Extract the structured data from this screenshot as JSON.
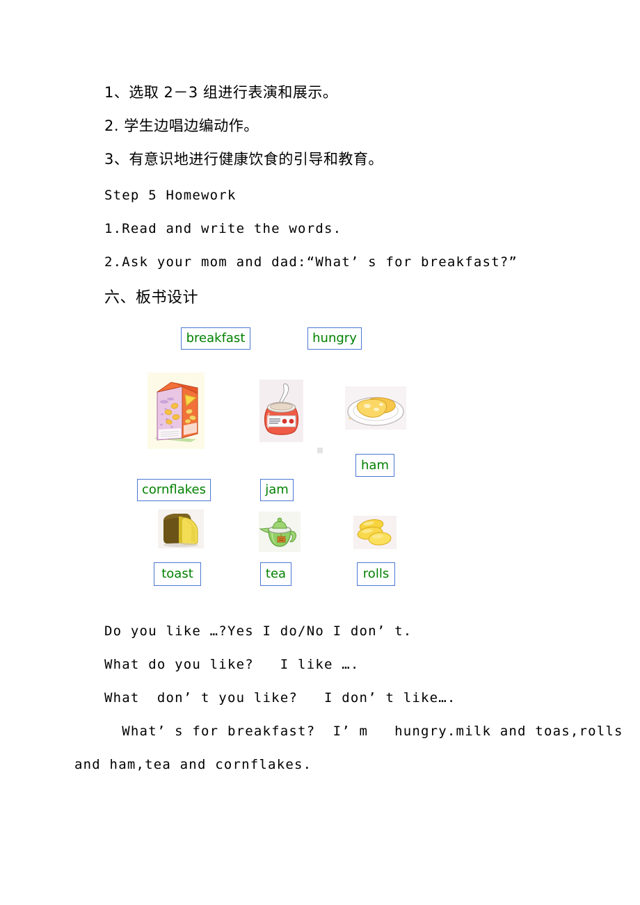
{
  "document": {
    "lesson_steps": [
      "1、选取 2－3 组进行表演和展示。",
      "2. 学生边唱边编动作。",
      "3、有意识地进行健康饮食的引导和教育。"
    ],
    "homework_heading": "Step 5 Homework",
    "homework_items": [
      "1.Read and write the words.",
      "2.Ask your mom and dad:“What’ s for breakfast?”"
    ],
    "blackboard_heading": "六、板书设计",
    "dialogue_lines": [
      "Do you like …?Yes I do/No I don’ t.",
      "What do you like?   I like ….",
      "What  don’ t you like?   I don’ t like….",
      "  What’ s for breakfast?  I’ m   hungry.milk and toas,rolls",
      "and ham,tea and cornflakes."
    ]
  },
  "blackboard": {
    "colors": {
      "word_text": "#008000",
      "word_border": "#4a76d4"
    },
    "top_words": [
      {
        "label": "breakfast",
        "name": "word-box-breakfast"
      },
      {
        "label": "hungry",
        "name": "word-box-hungry"
      }
    ],
    "food_items": [
      {
        "label": "cornflakes",
        "icon": "cereal-box-image"
      },
      {
        "label": "jam",
        "icon": "jam-jar-image"
      },
      {
        "label": "ham",
        "icon": "ham-on-plate-image"
      },
      {
        "label": "toast",
        "icon": "bread-loaf-image"
      },
      {
        "label": "tea",
        "icon": "teapot-image"
      },
      {
        "label": "rolls",
        "icon": "bread-rolls-image"
      }
    ]
  }
}
